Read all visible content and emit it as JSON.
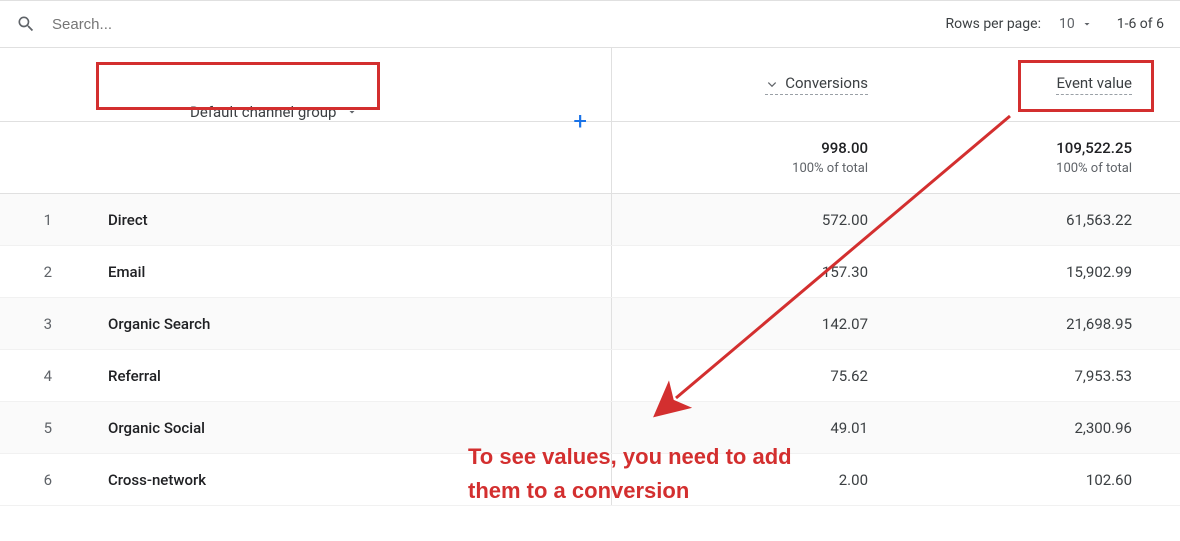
{
  "search": {
    "placeholder": "Search..."
  },
  "pager": {
    "rows_label": "Rows per page:",
    "rows_value": "10",
    "range": "1-6 of 6"
  },
  "dimension": {
    "label": "Default channel group"
  },
  "metrics": {
    "conversions_label": "Conversions",
    "event_value_label": "Event value"
  },
  "totals": {
    "conversions": "998.00",
    "conversions_pct": "100% of total",
    "event_value": "109,522.25",
    "event_value_pct": "100% of total"
  },
  "rows": [
    {
      "idx": "1",
      "name": "Direct",
      "conv": "572.00",
      "ev": "61,563.22"
    },
    {
      "idx": "2",
      "name": "Email",
      "conv": "157.30",
      "ev": "15,902.99"
    },
    {
      "idx": "3",
      "name": "Organic Search",
      "conv": "142.07",
      "ev": "21,698.95"
    },
    {
      "idx": "4",
      "name": "Referral",
      "conv": "75.62",
      "ev": "7,953.53"
    },
    {
      "idx": "5",
      "name": "Organic Social",
      "conv": "49.01",
      "ev": "2,300.96"
    },
    {
      "idx": "6",
      "name": "Cross-network",
      "conv": "2.00",
      "ev": "102.60"
    }
  ],
  "annotation": {
    "line1": "To see values, you need to add",
    "line2": "them to a conversion"
  },
  "colors": {
    "highlight": "#d32f2f",
    "link_blue": "#1a73e8"
  }
}
